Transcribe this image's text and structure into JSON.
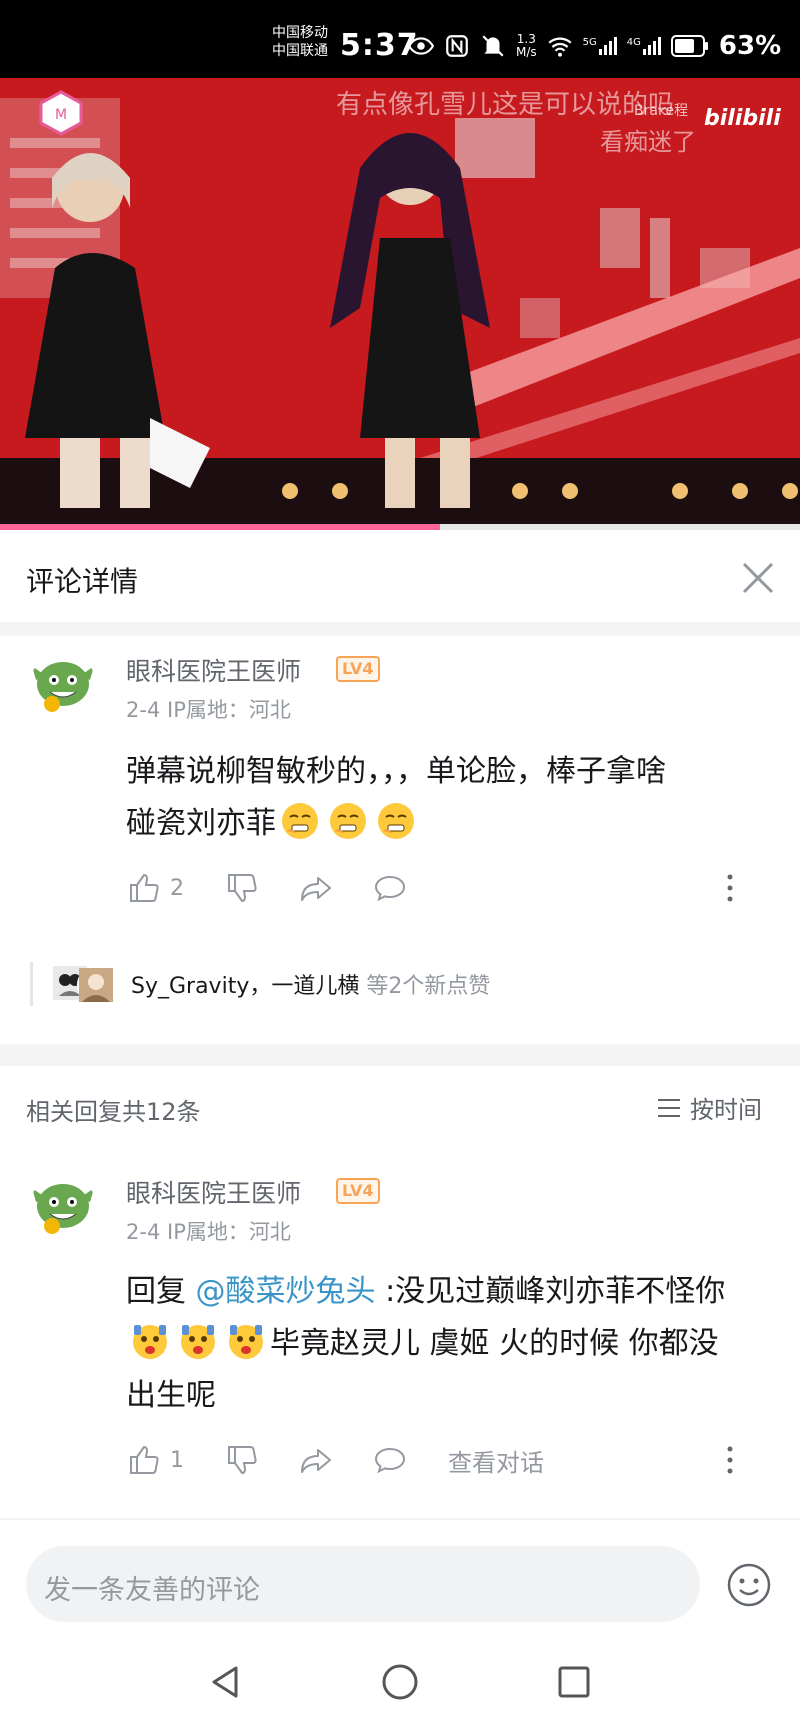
{
  "status_bar": {
    "carrier_top": "中国移动",
    "carrier_bottom": "中国联通",
    "time": "5:37",
    "net_speed_value": "1.3",
    "net_speed_unit": "M/s",
    "signal_1_label": "5G",
    "signal_2_label": "4G",
    "battery": "63%",
    "icons": [
      "eye-icon",
      "nfc-icon",
      "mute-icon",
      "wifi-icon",
      "signal-icon",
      "signal-icon",
      "battery-icon"
    ]
  },
  "video": {
    "danmaku_top": "有点像孔雪儿这是可以说的吗",
    "danmaku_bottom": "看痴迷了",
    "danmaku_small": "Brake程",
    "watermark": "bilibili",
    "progress": 0.55,
    "colors": {
      "stage_red": "#c8161d",
      "progress_pink": "#ff6699"
    }
  },
  "comment_panel": {
    "title": "评论详情",
    "close_icon": "close-icon"
  },
  "main_comment": {
    "username": "眼科医院王医师",
    "level": "LV4",
    "date": "2-4",
    "ip_location": "IP属地：河北",
    "text_line1": "弹幕说柳智敏秒的，，，单论脸，棒子拿啥",
    "text_line2": "碰瓷刘亦菲",
    "emoji_icons": [
      "grimace-emoji-icon",
      "grimace-emoji-icon",
      "grimace-emoji-icon"
    ],
    "like_count": "2",
    "liked_by_names": "Sy_Gravity，一道儿横",
    "liked_by_suffix": "等2个新点赞"
  },
  "replies_header": {
    "count_text": "相关回复共12条",
    "sort_label": "按时间"
  },
  "reply": {
    "username": "眼科医院王医师",
    "level": "LV4",
    "date": "2-4",
    "ip_location": "IP属地：河北",
    "prefix": "回复",
    "mention": "@酸菜炒兔头",
    "text_after_mention": ":没见过巅峰刘亦菲不怪你",
    "text_after_emoji": "毕竟赵灵儿 虞姬 火的时候 你都没",
    "text_line3": "出生呢",
    "emoji_icons": [
      "shocked-emoji-icon",
      "shocked-emoji-icon",
      "shocked-emoji-icon"
    ],
    "like_count": "1",
    "view_conversation": "查看对话"
  },
  "input": {
    "placeholder": "发一条友善的评论",
    "emoji_button_icon": "smiley-icon"
  },
  "nav": {
    "icons": [
      "back-icon",
      "home-icon",
      "recents-icon"
    ]
  }
}
